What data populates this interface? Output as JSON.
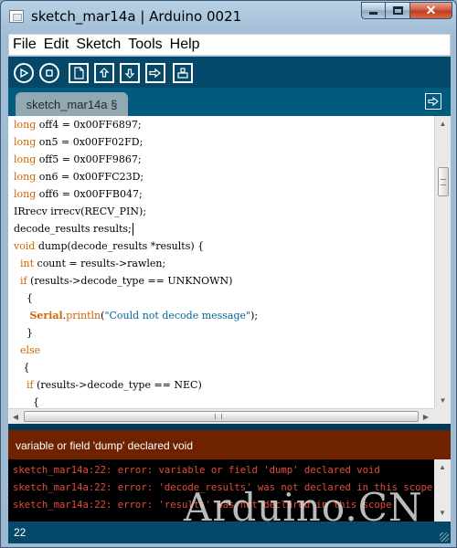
{
  "window": {
    "title": "sketch_mar14a | Arduino 0021",
    "buttons": {
      "minimize": "minimize",
      "maximize": "maximize",
      "close": "✕"
    }
  },
  "menu": [
    "File",
    "Edit",
    "Sketch",
    "Tools",
    "Help"
  ],
  "toolbar": {
    "icons": [
      "verify-icon",
      "stop-icon",
      "new-icon",
      "open-icon",
      "save-icon",
      "upload-icon",
      "serial-monitor-icon"
    ]
  },
  "tabs": [
    {
      "label": "sketch_mar14a §"
    }
  ],
  "editor": {
    "lines": [
      {
        "parts": [
          {
            "t": "long",
            "c": "kw"
          },
          {
            "t": " off4 = 0x00FF6897;"
          }
        ]
      },
      {
        "parts": [
          {
            "t": "long",
            "c": "kw"
          },
          {
            "t": " on5 = 0x00FF02FD;"
          }
        ]
      },
      {
        "parts": [
          {
            "t": "long",
            "c": "kw"
          },
          {
            "t": " off5 = 0x00FF9867;"
          }
        ]
      },
      {
        "parts": [
          {
            "t": "long",
            "c": "kw"
          },
          {
            "t": " on6 = 0x00FFC23D;"
          }
        ]
      },
      {
        "parts": [
          {
            "t": "long",
            "c": "kw"
          },
          {
            "t": " off6 = 0x00FFB047;"
          }
        ]
      },
      {
        "parts": [
          {
            "t": "IRrecv irrecv(RECV_PIN);"
          }
        ]
      },
      {
        "parts": [
          {
            "t": "decode_results results;"
          }
        ],
        "caret": true
      },
      {
        "parts": [
          {
            "t": "void",
            "c": "kw"
          },
          {
            "t": " dump(decode_results *results) {"
          }
        ]
      },
      {
        "parts": [
          {
            "t": "  "
          },
          {
            "t": "int",
            "c": "kw"
          },
          {
            "t": " count = results->rawlen;"
          }
        ]
      },
      {
        "parts": [
          {
            "t": "  "
          },
          {
            "t": "if",
            "c": "kw"
          },
          {
            "t": " (results->decode_type == UNKNOWN)"
          }
        ]
      },
      {
        "parts": [
          {
            "t": "    {"
          }
        ]
      },
      {
        "parts": [
          {
            "t": "     "
          },
          {
            "t": "Serial",
            "c": "kw-b"
          },
          {
            "t": "."
          },
          {
            "t": "println",
            "c": "kw"
          },
          {
            "t": "("
          },
          {
            "t": "\"Could not decode message\"",
            "c": "str"
          },
          {
            "t": ");"
          }
        ]
      },
      {
        "parts": [
          {
            "t": "    }"
          }
        ]
      },
      {
        "parts": [
          {
            "t": "  "
          },
          {
            "t": "else",
            "c": "kw"
          }
        ]
      },
      {
        "parts": [
          {
            "t": "   {"
          }
        ]
      },
      {
        "parts": [
          {
            "t": "    "
          },
          {
            "t": "if",
            "c": "kw"
          },
          {
            "t": " (results->decode_type == NEC)"
          }
        ]
      },
      {
        "parts": [
          {
            "t": "      {"
          }
        ]
      }
    ]
  },
  "error_message": "variable or field 'dump' declared void",
  "console": [
    "sketch_mar14a:22: error: variable or field 'dump' declared void",
    "sketch_mar14a:22: error: 'decode_results' was not declared in this scope",
    "sketch_mar14a:22: error: 'results' was not declared in this scope"
  ],
  "watermark": "Arduino.CN",
  "status": {
    "line_number": "22"
  },
  "colors": {
    "toolbar_bg": "#04486a",
    "tabs_bg": "#005b7e",
    "error_bar_bg": "#6e2200",
    "console_text": "#e34c3c",
    "keyword": "#cc6600",
    "string": "#006699"
  }
}
